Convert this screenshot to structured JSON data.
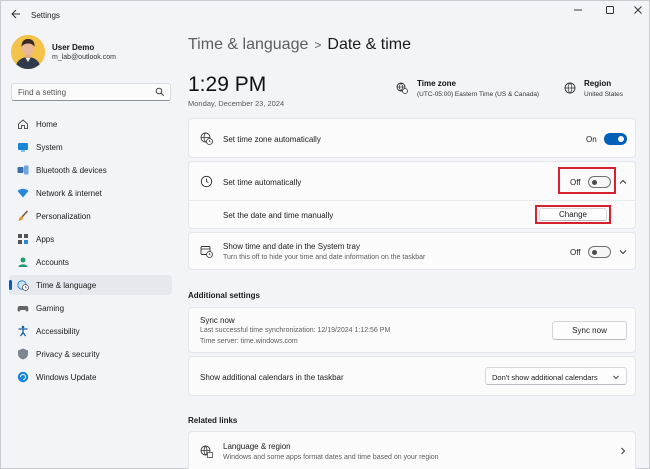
{
  "window": {
    "title": "Settings"
  },
  "user": {
    "name": "User Demo",
    "email": "m_lab@outlook.com"
  },
  "search": {
    "placeholder": "Find a setting"
  },
  "sidebar": {
    "items": [
      {
        "label": "Home",
        "icon": "home-icon"
      },
      {
        "label": "System",
        "icon": "system-icon"
      },
      {
        "label": "Bluetooth & devices",
        "icon": "bluetooth-icon"
      },
      {
        "label": "Network & internet",
        "icon": "wifi-icon"
      },
      {
        "label": "Personalization",
        "icon": "brush-icon"
      },
      {
        "label": "Apps",
        "icon": "apps-icon"
      },
      {
        "label": "Accounts",
        "icon": "accounts-icon"
      },
      {
        "label": "Time & language",
        "icon": "globe-clock-icon",
        "active": true
      },
      {
        "label": "Gaming",
        "icon": "gaming-icon"
      },
      {
        "label": "Accessibility",
        "icon": "accessibility-icon"
      },
      {
        "label": "Privacy & security",
        "icon": "shield-icon"
      },
      {
        "label": "Windows Update",
        "icon": "update-icon"
      }
    ]
  },
  "header": {
    "crumb_parent": "Time & language",
    "separator": ">",
    "crumb_current": "Date & time"
  },
  "clock": {
    "time": "1:29 PM",
    "date": "Monday, December 23, 2024"
  },
  "time_zone": {
    "title": "Time zone",
    "value": "(UTC-05:00) Eastern Time (US & Canada)"
  },
  "region": {
    "title": "Region",
    "value": "United States"
  },
  "settings": {
    "tz_auto": {
      "label": "Set time zone automatically",
      "state": "On"
    },
    "time_auto": {
      "label": "Set time automatically",
      "state": "Off"
    },
    "manual": {
      "label": "Set the date and time manually",
      "button": "Change"
    },
    "tray": {
      "label": "Show time and date in the System tray",
      "sub": "Turn this off to hide your time and date information on the taskbar",
      "state": "Off"
    }
  },
  "additional": {
    "title": "Additional settings",
    "sync": {
      "title": "Sync now",
      "last": "Last successful time synchronization: 12/19/2024 1:12:56 PM",
      "server": "Time server: time.windows.com",
      "button": "Sync now"
    },
    "calendars": {
      "label": "Show additional calendars in the taskbar",
      "selected": "Don't show additional calendars"
    }
  },
  "related": {
    "title": "Related links",
    "language": {
      "label": "Language & region",
      "sub": "Windows and some apps format dates and time based on your region"
    }
  },
  "colors": {
    "accent": "#005fb8",
    "highlight_border": "#d6222f"
  }
}
